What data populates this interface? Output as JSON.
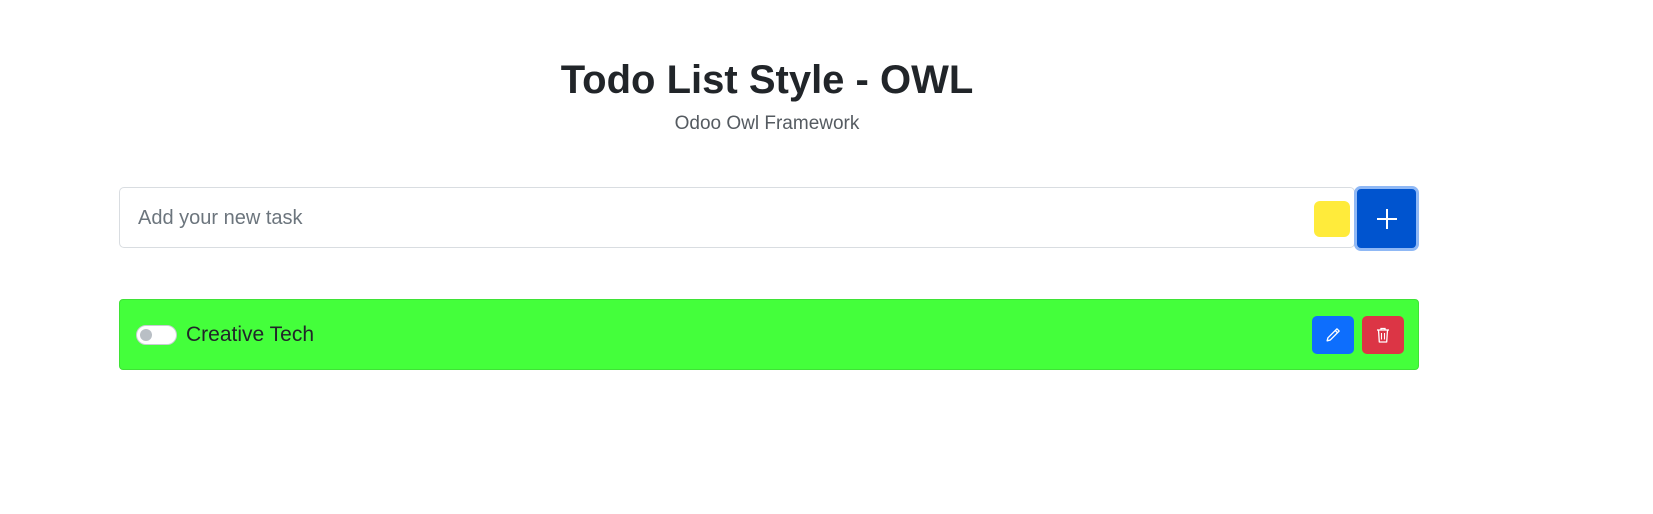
{
  "header": {
    "title": "Todo List Style - OWL",
    "subtitle": "Odoo Owl Framework"
  },
  "add_task": {
    "input_value": "",
    "input_placeholder": "Add your new task",
    "selected_color": "#ffeb3b",
    "add_button_icon": "plus-icon",
    "add_button_color": "#0054cf"
  },
  "tasks": [
    {
      "label": "Creative Tech",
      "color": "#44ff3b",
      "completed": false,
      "toggle_icon": "toggle-switch-icon",
      "edit_icon": "pencil-icon",
      "edit_color": "#0d6efd",
      "delete_icon": "trash-icon",
      "delete_color": "#dc3545"
    }
  ]
}
